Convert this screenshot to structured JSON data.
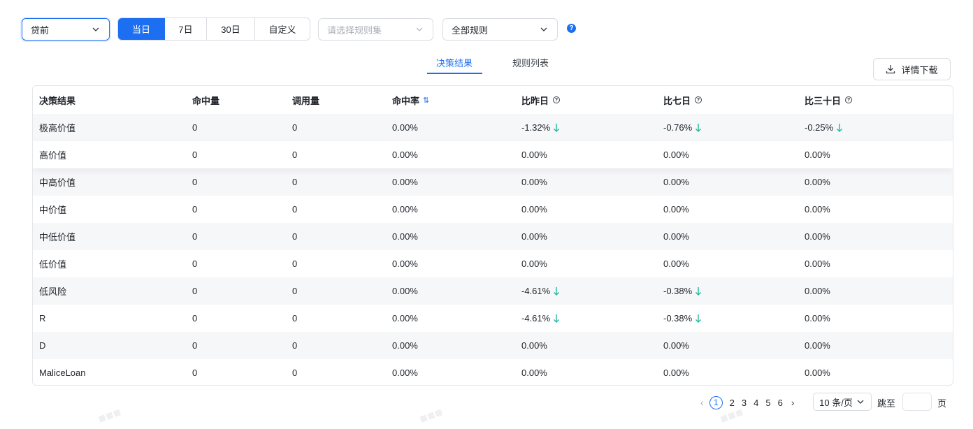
{
  "filters": {
    "stage_select": {
      "value": "贷前"
    },
    "date_range": {
      "options": [
        "当日",
        "7日",
        "30日",
        "自定义"
      ],
      "active_index": 0
    },
    "ruleset_select": {
      "placeholder": "请选择规则集"
    },
    "rule_select": {
      "value": "全部规则"
    },
    "help_icon": "question-circle-icon"
  },
  "tabs": {
    "items": [
      "决策结果",
      "规则列表"
    ],
    "active_index": 0
  },
  "download_button": {
    "label": "详情下载",
    "icon": "download-icon"
  },
  "table": {
    "columns": [
      "决策结果",
      "命中量",
      "调用量",
      "命中率",
      "比昨日",
      "比七日",
      "比三十日"
    ],
    "sortable_column": 3,
    "info_columns": [
      4,
      5,
      6
    ],
    "rows": [
      {
        "cells": [
          "极高价值",
          "0",
          "0",
          "0.00%",
          "-1.32%",
          "-0.76%",
          "-0.25%"
        ],
        "down": [
          4,
          5,
          6
        ]
      },
      {
        "cells": [
          "高价值",
          "0",
          "0",
          "0.00%",
          "0.00%",
          "0.00%",
          "0.00%"
        ],
        "down": []
      },
      {
        "cells": [
          "中高价值",
          "0",
          "0",
          "0.00%",
          "0.00%",
          "0.00%",
          "0.00%"
        ],
        "down": []
      },
      {
        "cells": [
          "中价值",
          "0",
          "0",
          "0.00%",
          "0.00%",
          "0.00%",
          "0.00%"
        ],
        "down": []
      },
      {
        "cells": [
          "中低价值",
          "0",
          "0",
          "0.00%",
          "0.00%",
          "0.00%",
          "0.00%"
        ],
        "down": []
      },
      {
        "cells": [
          "低价值",
          "0",
          "0",
          "0.00%",
          "0.00%",
          "0.00%",
          "0.00%"
        ],
        "down": []
      },
      {
        "cells": [
          "低风险",
          "0",
          "0",
          "0.00%",
          "-4.61%",
          "-0.38%",
          "0.00%"
        ],
        "down": [
          4,
          5
        ]
      },
      {
        "cells": [
          "R",
          "0",
          "0",
          "0.00%",
          "-4.61%",
          "-0.38%",
          "0.00%"
        ],
        "down": [
          4,
          5
        ]
      },
      {
        "cells": [
          "D",
          "0",
          "0",
          "0.00%",
          "0.00%",
          "0.00%",
          "0.00%"
        ],
        "down": []
      },
      {
        "cells": [
          "MaliceLoan",
          "0",
          "0",
          "0.00%",
          "0.00%",
          "0.00%",
          "0.00%"
        ],
        "down": []
      }
    ]
  },
  "pagination": {
    "pages": [
      "1",
      "2",
      "3",
      "4",
      "5",
      "6"
    ],
    "current_page": "1",
    "page_size": "10 条/页",
    "jump_label": "跳至",
    "page_suffix": "页"
  },
  "colors": {
    "primary": "#1d6ff2",
    "down_arrow": "#22b8a0",
    "stripe": "#f6f7f9"
  }
}
